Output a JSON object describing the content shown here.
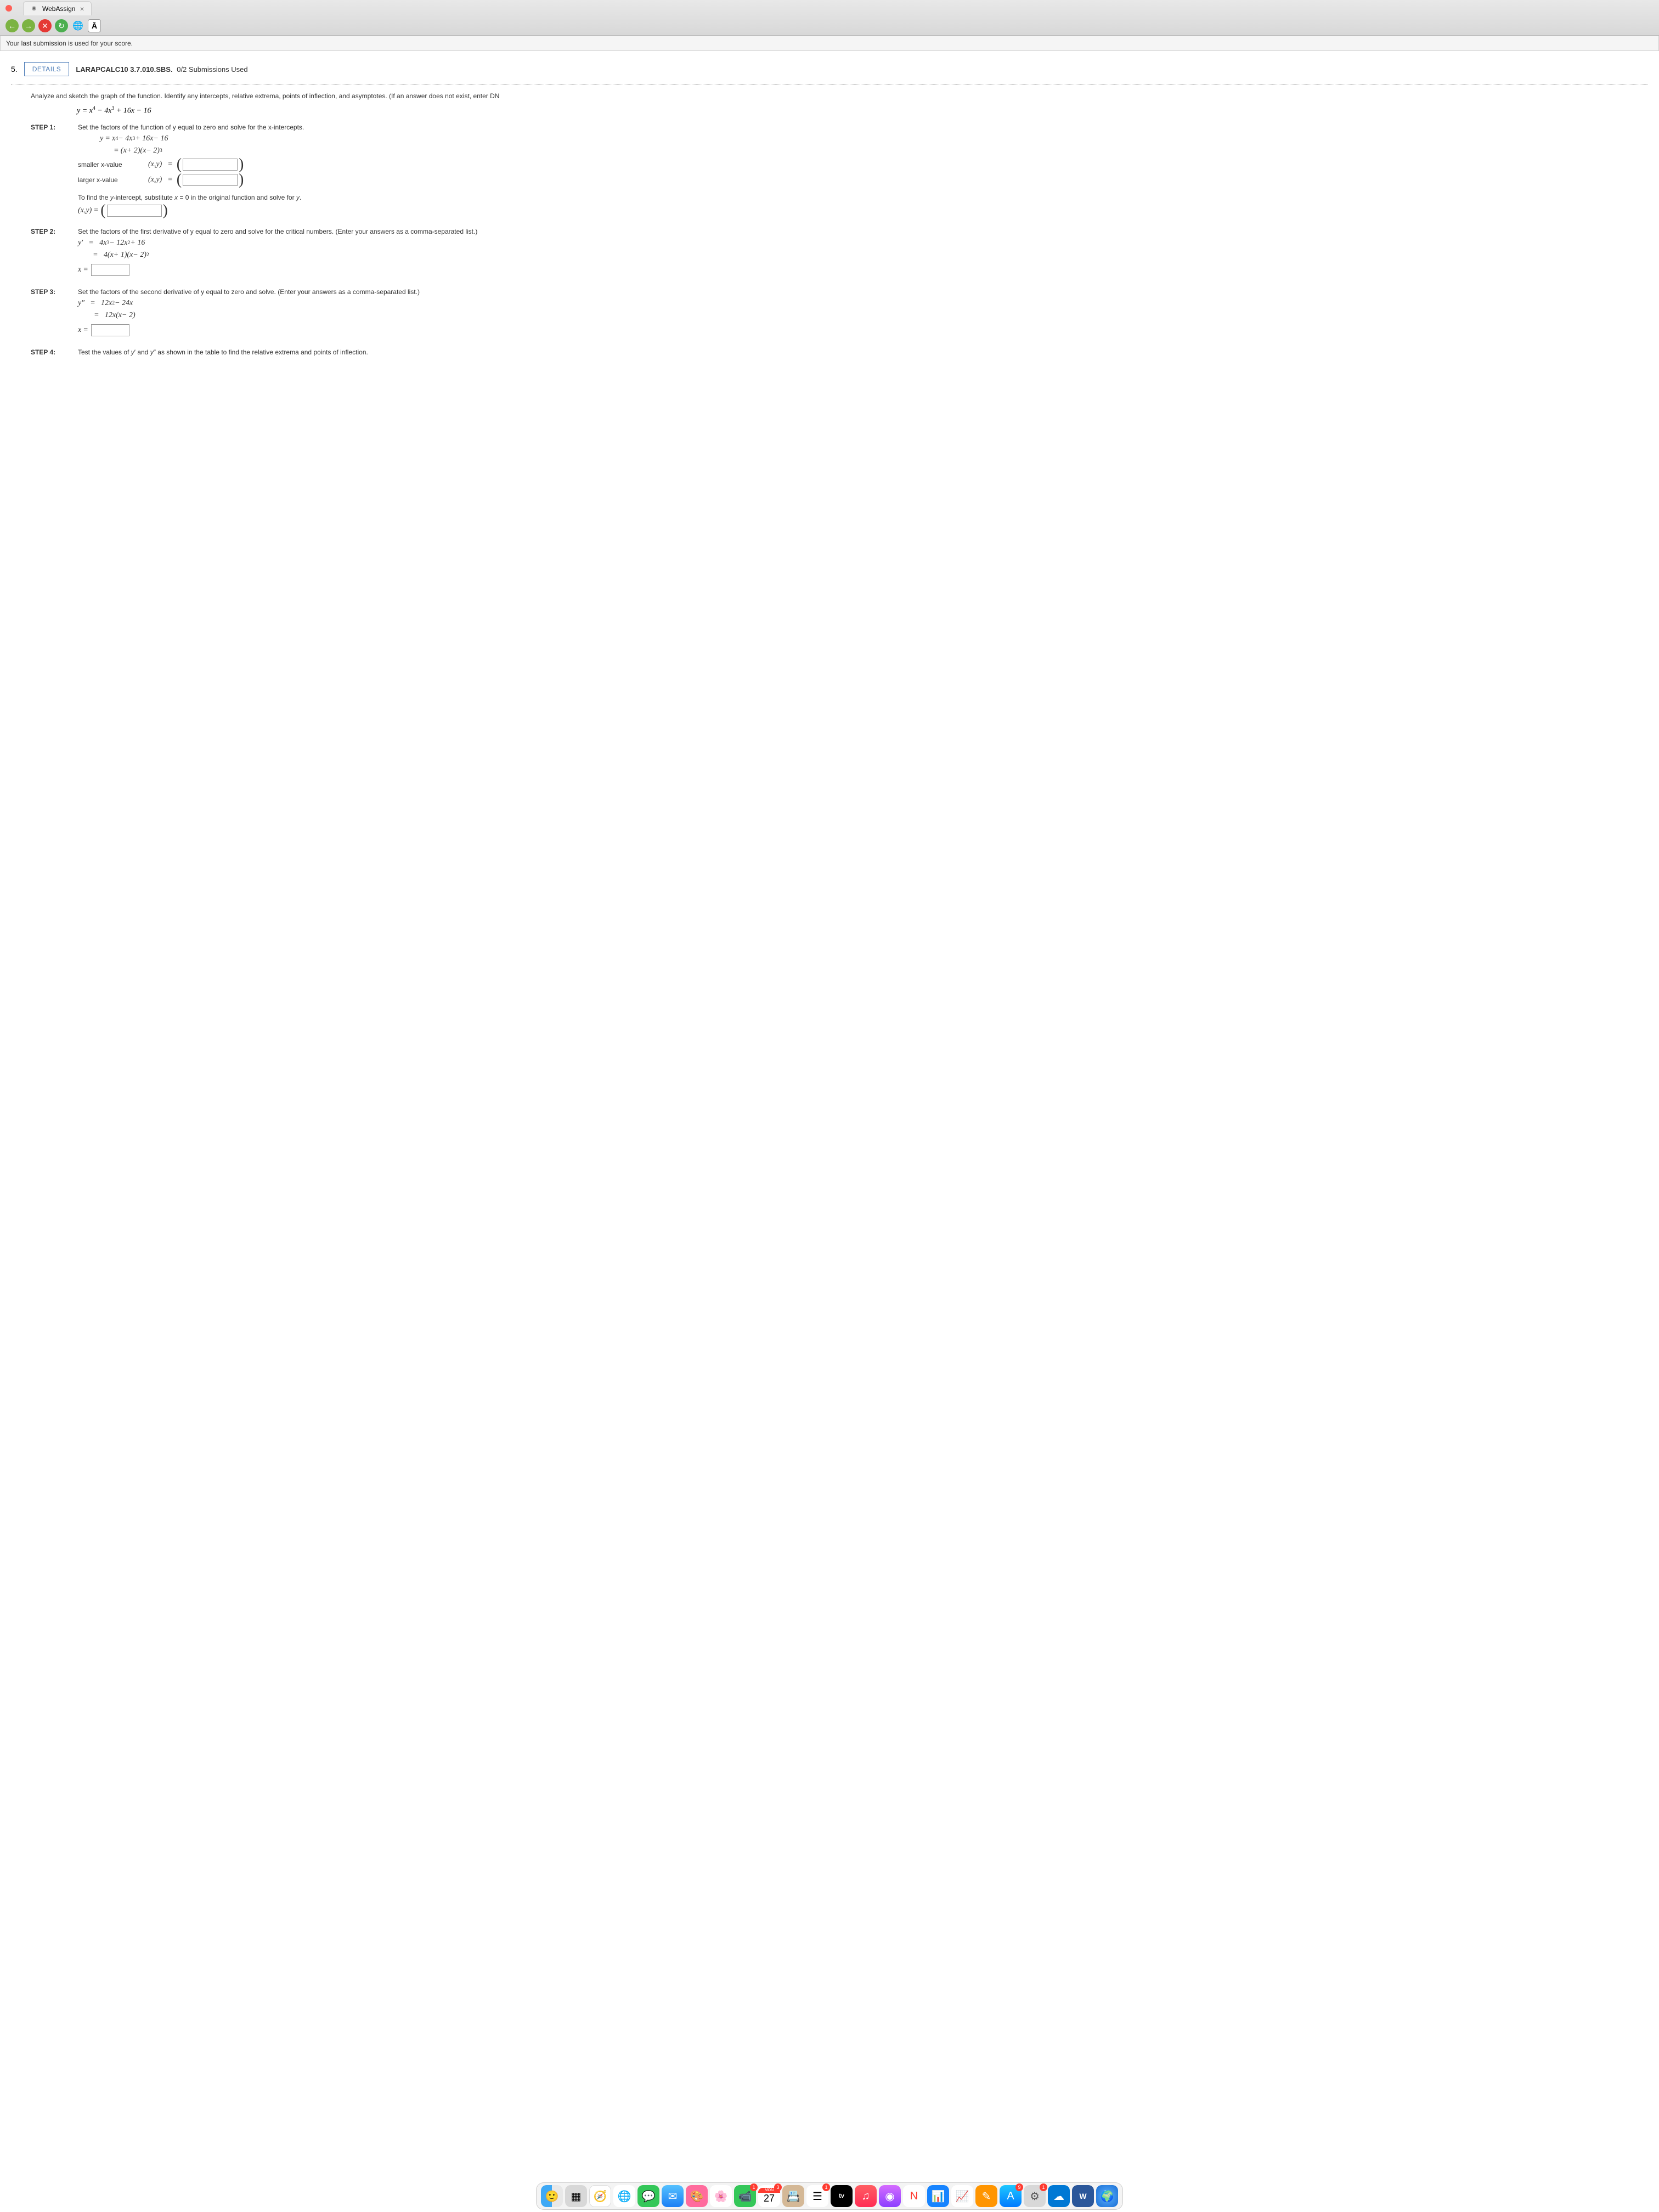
{
  "browser": {
    "tab_title": "WebAssign",
    "a_button": "Ā"
  },
  "banner": "Your last submission is used for your score.",
  "question": {
    "number": "5.",
    "details_btn": "DETAILS",
    "code": "LARAPCALC10 3.7.010.SBS.",
    "submissions": "0/2 Submissions Used"
  },
  "instructions": "Analyze and sketch the graph of the function. Identify any intercepts, relative extrema, points of inflection, and asymptotes. (If an answer does not exist, enter DN",
  "main_function": "y = x⁴ − 4x³ + 16x − 16",
  "step1": {
    "label": "STEP 1:",
    "text": "Set the factors of the function of y equal to zero and solve for the x-intercepts.",
    "line1": "y = x⁴ − 4x³ + 16x − 16",
    "line2": "= (x + 2)(x − 2)³",
    "smaller_label": "smaller x-value",
    "larger_label": "larger x-value",
    "xy_eq": "(x, y)  =",
    "yint_text": "To find the y-intercept, substitute x = 0 in the original function and solve for y.",
    "xy_eq2": "(x, y) ="
  },
  "step2": {
    "label": "STEP 2:",
    "text": "Set the factors of the first derivative of y equal to zero and solve for the critical numbers. (Enter your answers as a comma-separated list.)",
    "line1": "y′  =  4x³ − 12x² + 16",
    "line2": "=  4(x + 1)(x − 2)²",
    "x_eq": "x ="
  },
  "step3": {
    "label": "STEP 3:",
    "text": "Set the factors of the second derivative of y equal to zero and solve. (Enter your answers as a comma-separated list.)",
    "line1": "y″  =  12x² − 24x",
    "line2": "=  12x(x − 2)",
    "x_eq": "x ="
  },
  "step4": {
    "label": "STEP 4:",
    "text": "Test the values of y′ and y″ as shown in the table to find the relative extrema and points of inflection."
  },
  "dock": {
    "cal_mon": "MON",
    "cal_day": "27",
    "tv": "tv",
    "word": "W",
    "facetime_badge": "1",
    "reminders_badge": "1",
    "appstore_badge": "9",
    "settings_badge": "1",
    "mon_badge": "3"
  }
}
